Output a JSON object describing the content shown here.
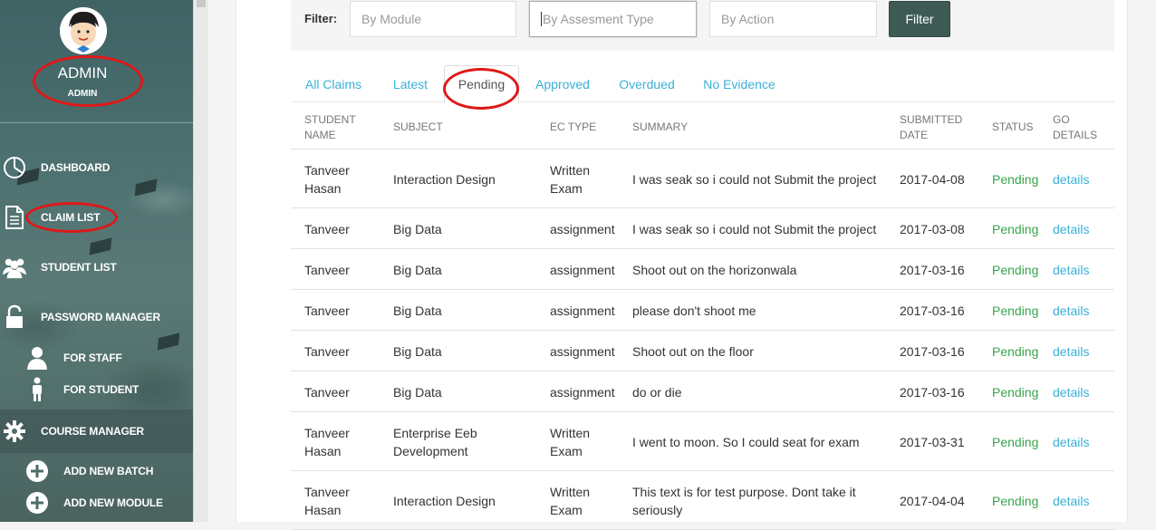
{
  "sidebar": {
    "user_name": "ADMIN",
    "user_role": "ADMIN",
    "items": [
      {
        "label": "DASHBOARD",
        "icon": "pie-chart-icon"
      },
      {
        "label": "CLAIM LIST",
        "icon": "document-icon"
      },
      {
        "label": "STUDENT LIST",
        "icon": "users-icon"
      },
      {
        "label": "PASSWORD MANAGER",
        "icon": "unlock-icon"
      },
      {
        "label": "FOR STAFF",
        "icon": "user-icon"
      },
      {
        "label": "FOR STUDENT",
        "icon": "student-icon"
      },
      {
        "label": "COURSE MANAGER",
        "icon": "gear-icon"
      },
      {
        "label": "ADD NEW BATCH",
        "icon": "plus-circle-icon"
      },
      {
        "label": "ADD NEW MODULE",
        "icon": "plus-circle-icon"
      }
    ]
  },
  "filter": {
    "label": "Filter:",
    "module_placeholder": "By Module",
    "assessment_placeholder": "By Assesment Type",
    "action_placeholder": "By Action",
    "button_label": "Filter"
  },
  "tabs": [
    {
      "label": "All Claims"
    },
    {
      "label": "Latest"
    },
    {
      "label": "Pending",
      "active": true
    },
    {
      "label": "Approved"
    },
    {
      "label": "Overdued"
    },
    {
      "label": "No Evidence"
    }
  ],
  "table": {
    "headers": {
      "student": [
        "STUDENT",
        "NAME"
      ],
      "subject": "SUBJECT",
      "ec_type": "EC TYPE",
      "summary": "SUMMARY",
      "submitted": [
        "SUBMITTED",
        "DATE"
      ],
      "status": "STATUS",
      "go": [
        "GO",
        "DETAILS"
      ]
    },
    "rows": [
      {
        "student": [
          "Tanveer",
          "Hasan"
        ],
        "subject": [
          "Interaction Design"
        ],
        "ec_type": [
          "Written",
          "Exam"
        ],
        "summary": [
          "I was seak so i could not Submit the project"
        ],
        "date": "2017-04-08",
        "status": "Pending",
        "link": "details"
      },
      {
        "student": [
          "Tanveer"
        ],
        "subject": [
          "Big Data"
        ],
        "ec_type": [
          "assignment"
        ],
        "summary": [
          "I was seak so i could not Submit the project"
        ],
        "date": "2017-03-08",
        "status": "Pending",
        "link": "details"
      },
      {
        "student": [
          "Tanveer"
        ],
        "subject": [
          "Big Data"
        ],
        "ec_type": [
          "assignment"
        ],
        "summary": [
          "Shoot out on the horizonwala"
        ],
        "date": "2017-03-16",
        "status": "Pending",
        "link": "details"
      },
      {
        "student": [
          "Tanveer"
        ],
        "subject": [
          "Big Data"
        ],
        "ec_type": [
          "assignment"
        ],
        "summary": [
          "please don't shoot me"
        ],
        "date": "2017-03-16",
        "status": "Pending",
        "link": "details"
      },
      {
        "student": [
          "Tanveer"
        ],
        "subject": [
          "Big Data"
        ],
        "ec_type": [
          "assignment"
        ],
        "summary": [
          "Shoot out on the floor"
        ],
        "date": "2017-03-16",
        "status": "Pending",
        "link": "details"
      },
      {
        "student": [
          "Tanveer"
        ],
        "subject": [
          "Big Data"
        ],
        "ec_type": [
          "assignment"
        ],
        "summary": [
          "do or die"
        ],
        "date": "2017-03-16",
        "status": "Pending",
        "link": "details"
      },
      {
        "student": [
          "Tanveer",
          "Hasan"
        ],
        "subject": [
          "Enterprise Eeb",
          "Development"
        ],
        "ec_type": [
          "Written",
          "Exam"
        ],
        "summary": [
          "I went to moon. So I could seat for exam"
        ],
        "date": "2017-03-31",
        "status": "Pending",
        "link": "details"
      },
      {
        "student": [
          "Tanveer",
          "Hasan"
        ],
        "subject": [
          "Interaction Design"
        ],
        "ec_type": [
          "Written",
          "Exam"
        ],
        "summary": [
          "This text is for test purpose. Dont take it",
          "seriously"
        ],
        "date": "2017-04-04",
        "status": "Pending",
        "link": "details"
      }
    ]
  },
  "colors": {
    "accent_link": "#3bb0d6",
    "status_pending": "#38a54c",
    "filter_button": "#3d5a55",
    "annotation_ring": "#e01818"
  }
}
